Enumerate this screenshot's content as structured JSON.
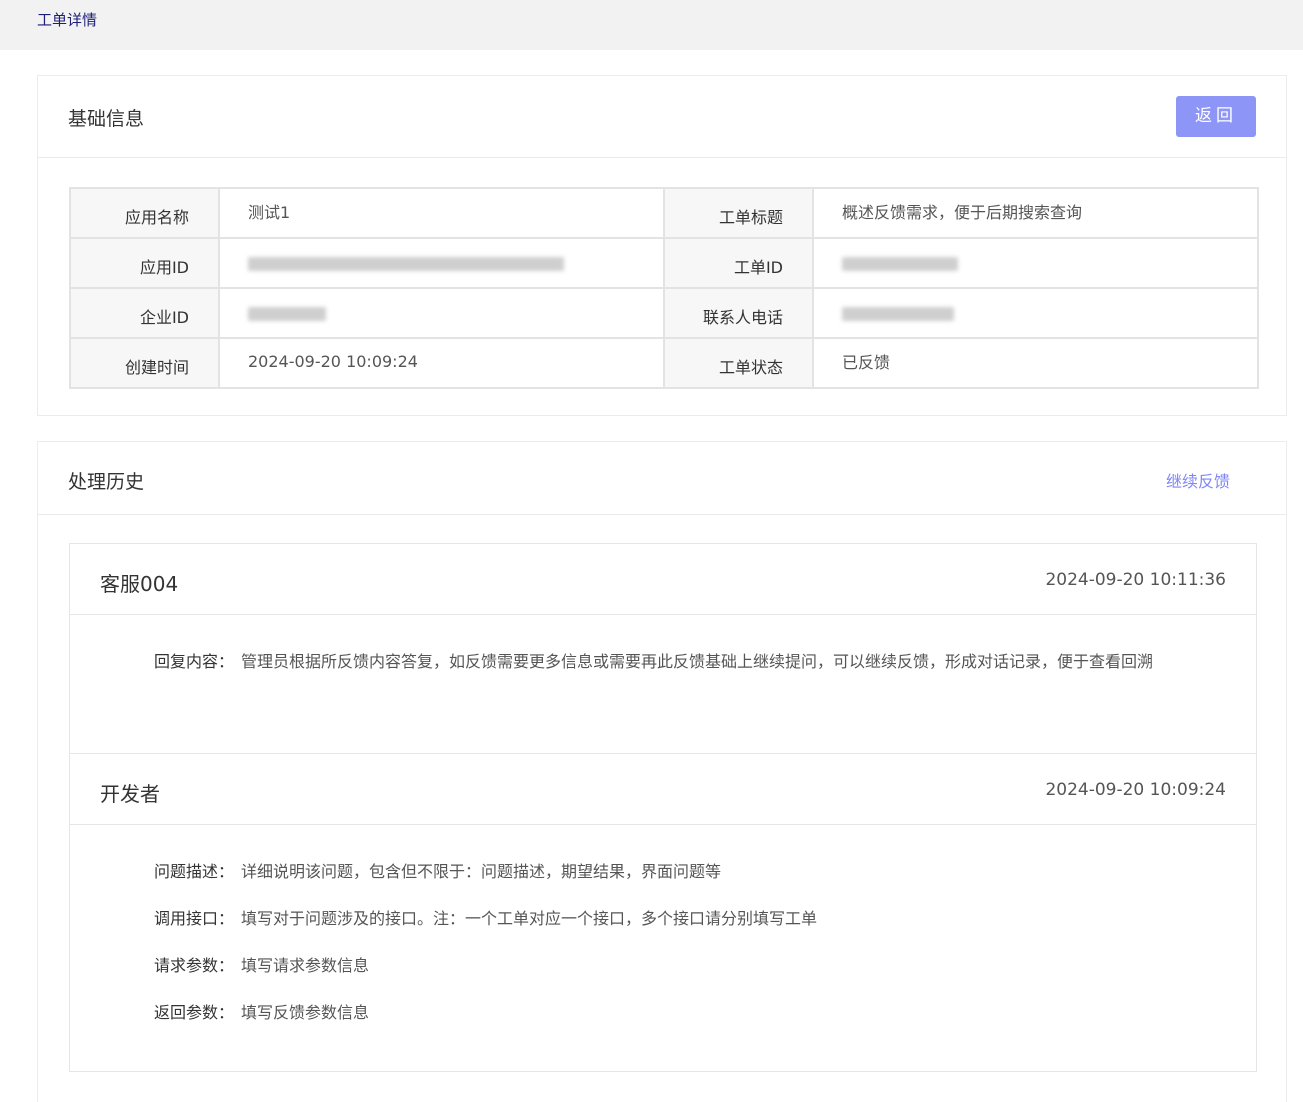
{
  "breadcrumb": "工单详情",
  "basic": {
    "title": "基础信息",
    "back_label": "返回",
    "rows": [
      {
        "l1": "应用名称",
        "v1": "测试1",
        "l2": "工单标题",
        "v2": "概述反馈需求，便于后期搜索查询"
      },
      {
        "l1": "应用ID",
        "v1": "",
        "l2": "工单ID",
        "v2": ""
      },
      {
        "l1": "企业ID",
        "v1": "",
        "l2": "联系人电话",
        "v2": ""
      },
      {
        "l1": "创建时间",
        "v1": "2024-09-20 10:09:24",
        "l2": "工单状态",
        "v2": "已反馈"
      }
    ]
  },
  "history": {
    "title": "处理历史",
    "continue_label": "继续反馈",
    "records": [
      {
        "author": "客服004",
        "time": "2024-09-20 10:11:36",
        "fields": [
          {
            "label": "回复内容：",
            "value": "管理员根据所反馈内容答复，如反馈需要更多信息或需要再此反馈基础上继续提问，可以继续反馈，形成对话记录，便于查看回溯"
          }
        ]
      },
      {
        "author": "开发者",
        "time": "2024-09-20 10:09:24",
        "fields": [
          {
            "label": "问题描述：",
            "value": "详细说明该问题，包含但不限于：问题描述，期望结果，界面问题等"
          },
          {
            "label": "调用接口：",
            "value": "填写对于问题涉及的接口。注：一个工单对应一个接口，多个接口请分别填写工单"
          },
          {
            "label": "请求参数：",
            "value": "填写请求参数信息"
          },
          {
            "label": "返回参数：",
            "value": "填写反馈参数信息"
          }
        ]
      }
    ]
  }
}
